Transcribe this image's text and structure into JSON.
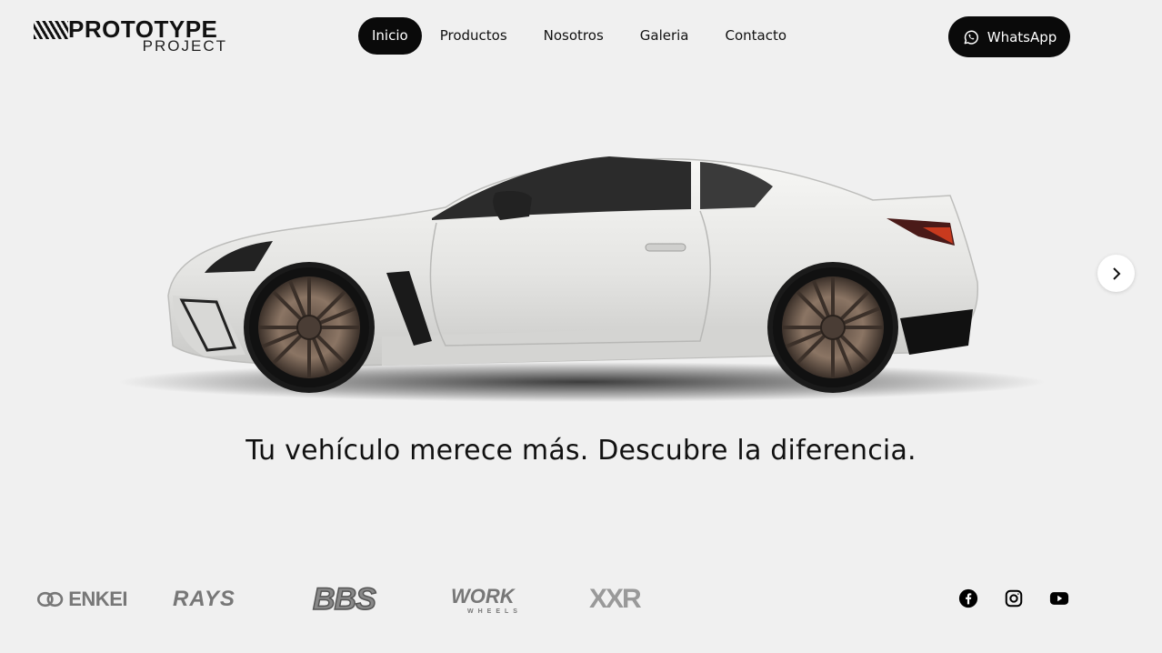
{
  "brand": {
    "name": "PROTOTYPE",
    "sub": "PROJECT"
  },
  "nav": [
    {
      "label": "Inicio",
      "active": true
    },
    {
      "label": "Productos",
      "active": false
    },
    {
      "label": "Nosotros",
      "active": false
    },
    {
      "label": "Galeria",
      "active": false
    },
    {
      "label": "Contacto",
      "active": false
    }
  ],
  "whatsapp": {
    "label": "WhatsApp",
    "icon": "whatsapp-icon"
  },
  "hero": {
    "tagline": "Tu vehículo merece más. Descubre la diferencia.",
    "next_icon": "chevron-right-icon"
  },
  "brands": [
    {
      "name": "ENKEI"
    },
    {
      "name": "RAYS"
    },
    {
      "name": "BBS"
    },
    {
      "name": "WORK",
      "sub": "WHEELS"
    },
    {
      "name": "XXR"
    }
  ],
  "social": [
    "facebook-icon",
    "instagram-icon",
    "youtube-icon"
  ],
  "colors": {
    "background": "#f0f0f0",
    "accent": "#0a0a0a",
    "text": "#111111"
  }
}
